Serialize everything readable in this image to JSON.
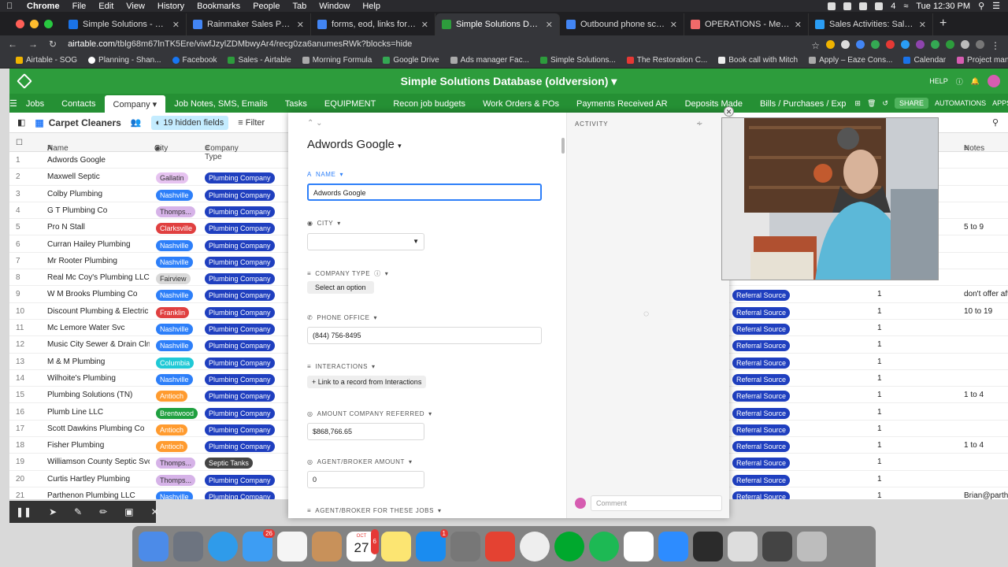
{
  "menubar": {
    "items": [
      "Chrome",
      "File",
      "Edit",
      "View",
      "History",
      "Bookmarks",
      "People",
      "Tab",
      "Window",
      "Help"
    ],
    "clock": "Tue 12:30 PM",
    "battery_num": "4"
  },
  "browser": {
    "tabs": [
      {
        "label": "Simple Solutions - Calendar -",
        "color": "#1a73e8"
      },
      {
        "label": "Rainmaker Sales Project Docu",
        "color": "#4285f4"
      },
      {
        "label": "forms, eod, links for slack - Go",
        "color": "#4285f4"
      },
      {
        "label": "Simple Solutions Database (old",
        "color": "#2d9c3c"
      },
      {
        "label": "Outbound phone script - Raim",
        "color": "#4285f4"
      },
      {
        "label": "OPERATIONS - Meeting Age",
        "color": "#f06a6a"
      },
      {
        "label": "Sales Activities: Sales Activiti",
        "color": "#2a9df4"
      }
    ],
    "new_tab": "+",
    "url_domain": "airtable.com",
    "url_path": "/tblg68m67lnTK5Ere/viwfJzylZDMbwyAr4/recg0za6anumesRWk?blocks=hide"
  },
  "bookmarks": [
    {
      "label": "Airtable - SOG",
      "color": "#f0b400"
    },
    {
      "label": "Planning - Shan...",
      "color": "#ffffff"
    },
    {
      "label": "Facebook",
      "color": "#1877f2"
    },
    {
      "label": "Sales - Airtable",
      "color": "#2d9c3c"
    },
    {
      "label": "Morning Formula",
      "color": "#aaaaaa"
    },
    {
      "label": "Google Drive",
      "color": "#34a853"
    },
    {
      "label": "Ads manager Fac...",
      "color": "#aaaaaa"
    },
    {
      "label": "Simple Solutions...",
      "color": "#2d9c3c"
    },
    {
      "label": "The Restoration C...",
      "color": "#e53935"
    },
    {
      "label": "Book call with Mitch",
      "color": "#eeeeee"
    },
    {
      "label": "Apply – Eaze Cons...",
      "color": "#aaaaaa"
    },
    {
      "label": "Calendar",
      "color": "#1a73e8"
    },
    {
      "label": "Project managem...",
      "color": "#d65db1"
    }
  ],
  "airtable": {
    "base_title": "Simple Solutions Database (oldversion) ▾",
    "help": "HELP",
    "tables": [
      "Jobs",
      "Contacts",
      "Company ▾",
      "Job Notes, SMS, Emails",
      "Tasks",
      "EQUIPMENT",
      "Recon job budgets",
      "Work Orders & POs",
      "Payments Received AR",
      "Deposits Made",
      "Bills / Purchases / Exp"
    ],
    "active_table_index": 2,
    "share": "SHARE",
    "automations": "AUTOMATIONS",
    "apps": "APPS",
    "view_name": "Carpet Cleaners",
    "hidden_fields": "19 hidden fields",
    "filter": "Filter"
  },
  "grid": {
    "headers": {
      "name": "Name",
      "city": "City",
      "company_type": "Company Type",
      "notes": "Notes"
    },
    "rows": [
      {
        "num": "1",
        "name": "Adwords Google",
        "city": "",
        "type": "",
        "source": "",
        "count": "",
        "notes": ""
      },
      {
        "num": "2",
        "name": "Maxwell Septic",
        "city": "Gallatin",
        "type": "Plumbing Company",
        "source": "",
        "count": "",
        "notes": ""
      },
      {
        "num": "3",
        "name": "Colby Plumbing",
        "city": "Nashville",
        "type": "Plumbing Company",
        "source": "",
        "count": "",
        "notes": ""
      },
      {
        "num": "4",
        "name": "G T Plumbing Co",
        "city": "Thomps...",
        "type": "Plumbing Company",
        "source": "",
        "count": "",
        "notes": ""
      },
      {
        "num": "5",
        "name": "Pro N Stall",
        "city": "Clarksville",
        "type": "Plumbing Company",
        "source": "",
        "count": "",
        "notes": "5 to 9"
      },
      {
        "num": "6",
        "name": "Curran Hailey Plumbing",
        "city": "Nashville",
        "type": "Plumbing Company",
        "source": "",
        "count": "",
        "notes": ""
      },
      {
        "num": "7",
        "name": "Mr Rooter Plumbing",
        "city": "Nashville",
        "type": "Plumbing Company",
        "source": "",
        "count": "",
        "notes": ""
      },
      {
        "num": "8",
        "name": "Real Mc Coy's Plumbing LLC",
        "city": "Fairview",
        "type": "Plumbing Company",
        "source": "",
        "count": "",
        "notes": ""
      },
      {
        "num": "9",
        "name": "W M Brooks Plumbing Co",
        "city": "Nashville",
        "type": "Plumbing Company",
        "source": "Referral Source",
        "count": "1",
        "notes": "don't offer aft"
      },
      {
        "num": "10",
        "name": "Discount Plumbing & Electric",
        "city": "Franklin",
        "type": "Plumbing Company",
        "source": "Referral Source",
        "count": "1",
        "notes": "10 to 19"
      },
      {
        "num": "11",
        "name": "Mc Lemore Water Svc",
        "city": "Nashville",
        "type": "Plumbing Company",
        "source": "Referral Source",
        "count": "1",
        "notes": ""
      },
      {
        "num": "12",
        "name": "Music City Sewer & Drain Clng",
        "city": "Nashville",
        "type": "Plumbing Company",
        "source": "Referral Source",
        "count": "1",
        "notes": ""
      },
      {
        "num": "13",
        "name": "M & M Plumbing",
        "city": "Columbia",
        "type": "Plumbing Company",
        "source": "Referral Source",
        "count": "1",
        "notes": ""
      },
      {
        "num": "14",
        "name": "Wilhoite's Plumbing",
        "city": "Nashville",
        "type": "Plumbing Company",
        "source": "Referral Source",
        "count": "1",
        "notes": ""
      },
      {
        "num": "15",
        "name": "Plumbing Solutions (TN)",
        "city": "Antioch",
        "type": "Plumbing Company",
        "source": "Referral Source",
        "count": "1",
        "notes": "1 to 4"
      },
      {
        "num": "16",
        "name": "Plumb Line LLC",
        "city": "Brentwood",
        "type": "Plumbing Company",
        "source": "Referral Source",
        "count": "1",
        "notes": ""
      },
      {
        "num": "17",
        "name": "Scott Dawkins Plumbing Co",
        "city": "Antioch",
        "type": "Plumbing Company",
        "source": "Referral Source",
        "count": "1",
        "notes": ""
      },
      {
        "num": "18",
        "name": "Fisher Plumbing",
        "city": "Antioch",
        "type": "Plumbing Company",
        "source": "Referral Source",
        "count": "1",
        "notes": "1 to 4"
      },
      {
        "num": "19",
        "name": "Williamson County Septic Svc",
        "city": "Thomps...",
        "type": "Septic Tanks",
        "source": "Referral Source",
        "count": "1",
        "notes": ""
      },
      {
        "num": "20",
        "name": "Curtis Hartley Plumbing",
        "city": "Thomps...",
        "type": "Plumbing Company",
        "source": "Referral Source",
        "count": "1",
        "notes": ""
      },
      {
        "num": "21",
        "name": "Parthenon Plumbing LLC",
        "city": "Nashville",
        "type": "Plumbing Company",
        "source": "Referral Source",
        "count": "1",
        "notes": "Brian@parthe"
      }
    ],
    "city_colors": {
      "Gallatin": "#e6c3f0",
      "Nashville": "#2d7ff9",
      "Thomps...": "#d6b3e8",
      "Clarksville": "#e04040",
      "Fairview": "#d9d9d9",
      "Franklin": "#e04040",
      "Columbia": "#20c9d6",
      "Antioch": "#ff9b2f",
      "Brentwood": "#20a040"
    }
  },
  "record": {
    "title": "Adwords Google",
    "name_label": "NAME",
    "name_value": "Adwords Google",
    "city_label": "CITY",
    "company_type_label": "COMPANY TYPE",
    "select_option": "Select an option",
    "phone_label": "PHONE OFFICE",
    "phone_value": "(844) 756-8495",
    "interactions_label": "INTERACTIONS",
    "link_record": "+ Link to a record from Interactions",
    "amount_label": "AMOUNT COMPANY REFERRED",
    "amount_value": "$868,766.65",
    "agent_amount_label": "AGENT/BROKER AMOUNT",
    "agent_amount_value": "0",
    "agent_jobs_label": "AGENT/BROKER FOR THESE JOBS",
    "activity_label": "ACTIVITY",
    "comment_placeholder": "Comment"
  },
  "dock": {
    "calendar_month": "OCT",
    "calendar_day": "27",
    "badges": {
      "messages": "26",
      "calendar": "6",
      "appstore": "1"
    }
  }
}
